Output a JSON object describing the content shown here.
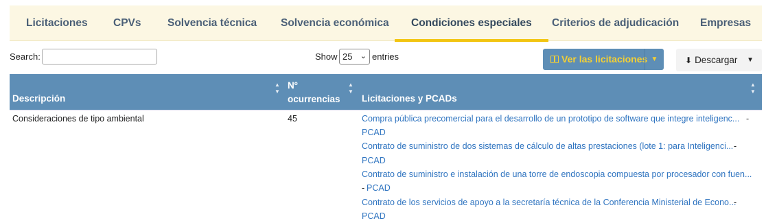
{
  "tabs": [
    {
      "label": "Licitaciones"
    },
    {
      "label": "CPVs"
    },
    {
      "label": "Solvencia técnica"
    },
    {
      "label": "Solvencia económica"
    },
    {
      "label": "Condiciones especiales"
    },
    {
      "label": "Criterios de adjudicación"
    },
    {
      "label": "Empresas"
    }
  ],
  "active_tab": "Condiciones especiales",
  "controls": {
    "search_label": "Search:",
    "search_value": "",
    "show_label": "Show",
    "show_value": "25",
    "entries_label": "entries",
    "ver_button": "Ver las licitaciones",
    "download_button": "Descargar"
  },
  "table": {
    "headers": {
      "descripcion": "Descripción",
      "ocurrencias_line1": "Nº",
      "ocurrencias_line2": "ocurrencias",
      "licitaciones": "Licitaciones y PCADs"
    },
    "row": {
      "descripcion": "Consideraciones de tipo ambiental",
      "ocurrencias": "45",
      "links": [
        {
          "title": "Compra pública precomercial para el desarrollo de un prototipo de software que integre inteligenc...",
          "sep": " -",
          "pcad": "PCAD"
        },
        {
          "title": "Contrato de suministro de dos sistemas de cálculo de altas prestaciones (lote 1: para Inteligenci...",
          "sep": " -",
          "pcad": "PCAD"
        },
        {
          "title": "Contrato de suministro e instalación de una torre de endoscopia compuesta por procesador con fuen...",
          "sep": "- ",
          "pcad": "PCAD"
        },
        {
          "title": "Contrato de los servicios de apoyo a la secretaría técnica de la Conferencia Ministerial de Econo...",
          "sep": " -",
          "pcad": "PCAD"
        }
      ]
    }
  }
}
